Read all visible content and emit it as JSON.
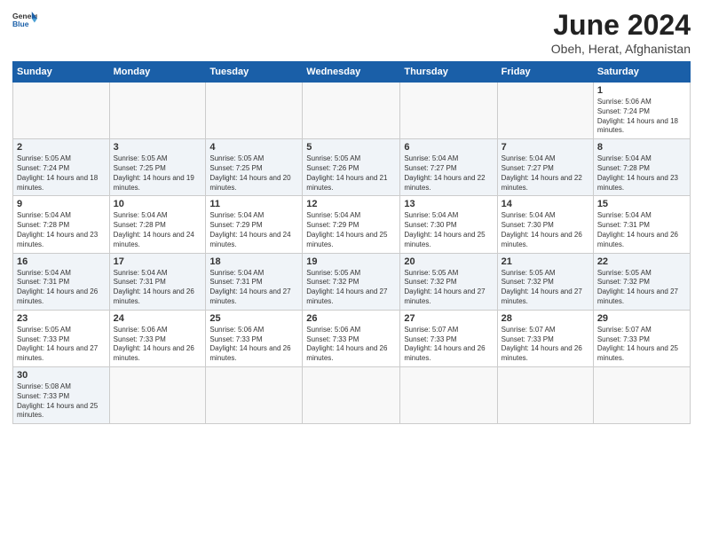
{
  "header": {
    "logo_general": "General",
    "logo_blue": "Blue",
    "month_title": "June 2024",
    "location": "Obeh, Herat, Afghanistan"
  },
  "weekdays": [
    "Sunday",
    "Monday",
    "Tuesday",
    "Wednesday",
    "Thursday",
    "Friday",
    "Saturday"
  ],
  "weeks": [
    [
      {
        "day": "",
        "info": ""
      },
      {
        "day": "",
        "info": ""
      },
      {
        "day": "",
        "info": ""
      },
      {
        "day": "",
        "info": ""
      },
      {
        "day": "",
        "info": ""
      },
      {
        "day": "",
        "info": ""
      },
      {
        "day": "1",
        "info": "Sunrise: 5:06 AM\nSunset: 7:24 PM\nDaylight: 14 hours and 18 minutes."
      }
    ],
    [
      {
        "day": "2",
        "info": "Sunrise: 5:05 AM\nSunset: 7:24 PM\nDaylight: 14 hours and 18 minutes."
      },
      {
        "day": "3",
        "info": "Sunrise: 5:05 AM\nSunset: 7:25 PM\nDaylight: 14 hours and 19 minutes."
      },
      {
        "day": "4",
        "info": "Sunrise: 5:05 AM\nSunset: 7:25 PM\nDaylight: 14 hours and 20 minutes."
      },
      {
        "day": "5",
        "info": "Sunrise: 5:05 AM\nSunset: 7:26 PM\nDaylight: 14 hours and 21 minutes."
      },
      {
        "day": "6",
        "info": "Sunrise: 5:04 AM\nSunset: 7:27 PM\nDaylight: 14 hours and 22 minutes."
      },
      {
        "day": "7",
        "info": "Sunrise: 5:04 AM\nSunset: 7:27 PM\nDaylight: 14 hours and 22 minutes."
      },
      {
        "day": "8",
        "info": "Sunrise: 5:04 AM\nSunset: 7:28 PM\nDaylight: 14 hours and 23 minutes."
      }
    ],
    [
      {
        "day": "9",
        "info": "Sunrise: 5:04 AM\nSunset: 7:28 PM\nDaylight: 14 hours and 23 minutes."
      },
      {
        "day": "10",
        "info": "Sunrise: 5:04 AM\nSunset: 7:28 PM\nDaylight: 14 hours and 24 minutes."
      },
      {
        "day": "11",
        "info": "Sunrise: 5:04 AM\nSunset: 7:29 PM\nDaylight: 14 hours and 24 minutes."
      },
      {
        "day": "12",
        "info": "Sunrise: 5:04 AM\nSunset: 7:29 PM\nDaylight: 14 hours and 25 minutes."
      },
      {
        "day": "13",
        "info": "Sunrise: 5:04 AM\nSunset: 7:30 PM\nDaylight: 14 hours and 25 minutes."
      },
      {
        "day": "14",
        "info": "Sunrise: 5:04 AM\nSunset: 7:30 PM\nDaylight: 14 hours and 26 minutes."
      },
      {
        "day": "15",
        "info": "Sunrise: 5:04 AM\nSunset: 7:31 PM\nDaylight: 14 hours and 26 minutes."
      }
    ],
    [
      {
        "day": "16",
        "info": "Sunrise: 5:04 AM\nSunset: 7:31 PM\nDaylight: 14 hours and 26 minutes."
      },
      {
        "day": "17",
        "info": "Sunrise: 5:04 AM\nSunset: 7:31 PM\nDaylight: 14 hours and 26 minutes."
      },
      {
        "day": "18",
        "info": "Sunrise: 5:04 AM\nSunset: 7:31 PM\nDaylight: 14 hours and 27 minutes."
      },
      {
        "day": "19",
        "info": "Sunrise: 5:05 AM\nSunset: 7:32 PM\nDaylight: 14 hours and 27 minutes."
      },
      {
        "day": "20",
        "info": "Sunrise: 5:05 AM\nSunset: 7:32 PM\nDaylight: 14 hours and 27 minutes."
      },
      {
        "day": "21",
        "info": "Sunrise: 5:05 AM\nSunset: 7:32 PM\nDaylight: 14 hours and 27 minutes."
      },
      {
        "day": "22",
        "info": "Sunrise: 5:05 AM\nSunset: 7:32 PM\nDaylight: 14 hours and 27 minutes."
      }
    ],
    [
      {
        "day": "23",
        "info": "Sunrise: 5:05 AM\nSunset: 7:33 PM\nDaylight: 14 hours and 27 minutes."
      },
      {
        "day": "24",
        "info": "Sunrise: 5:06 AM\nSunset: 7:33 PM\nDaylight: 14 hours and 26 minutes."
      },
      {
        "day": "25",
        "info": "Sunrise: 5:06 AM\nSunset: 7:33 PM\nDaylight: 14 hours and 26 minutes."
      },
      {
        "day": "26",
        "info": "Sunrise: 5:06 AM\nSunset: 7:33 PM\nDaylight: 14 hours and 26 minutes."
      },
      {
        "day": "27",
        "info": "Sunrise: 5:07 AM\nSunset: 7:33 PM\nDaylight: 14 hours and 26 minutes."
      },
      {
        "day": "28",
        "info": "Sunrise: 5:07 AM\nSunset: 7:33 PM\nDaylight: 14 hours and 26 minutes."
      },
      {
        "day": "29",
        "info": "Sunrise: 5:07 AM\nSunset: 7:33 PM\nDaylight: 14 hours and 25 minutes."
      }
    ],
    [
      {
        "day": "30",
        "info": "Sunrise: 5:08 AM\nSunset: 7:33 PM\nDaylight: 14 hours and 25 minutes."
      },
      {
        "day": "",
        "info": ""
      },
      {
        "day": "",
        "info": ""
      },
      {
        "day": "",
        "info": ""
      },
      {
        "day": "",
        "info": ""
      },
      {
        "day": "",
        "info": ""
      },
      {
        "day": "",
        "info": ""
      }
    ]
  ],
  "row_styles": [
    "normal",
    "alt",
    "normal",
    "alt",
    "normal",
    "alt"
  ]
}
